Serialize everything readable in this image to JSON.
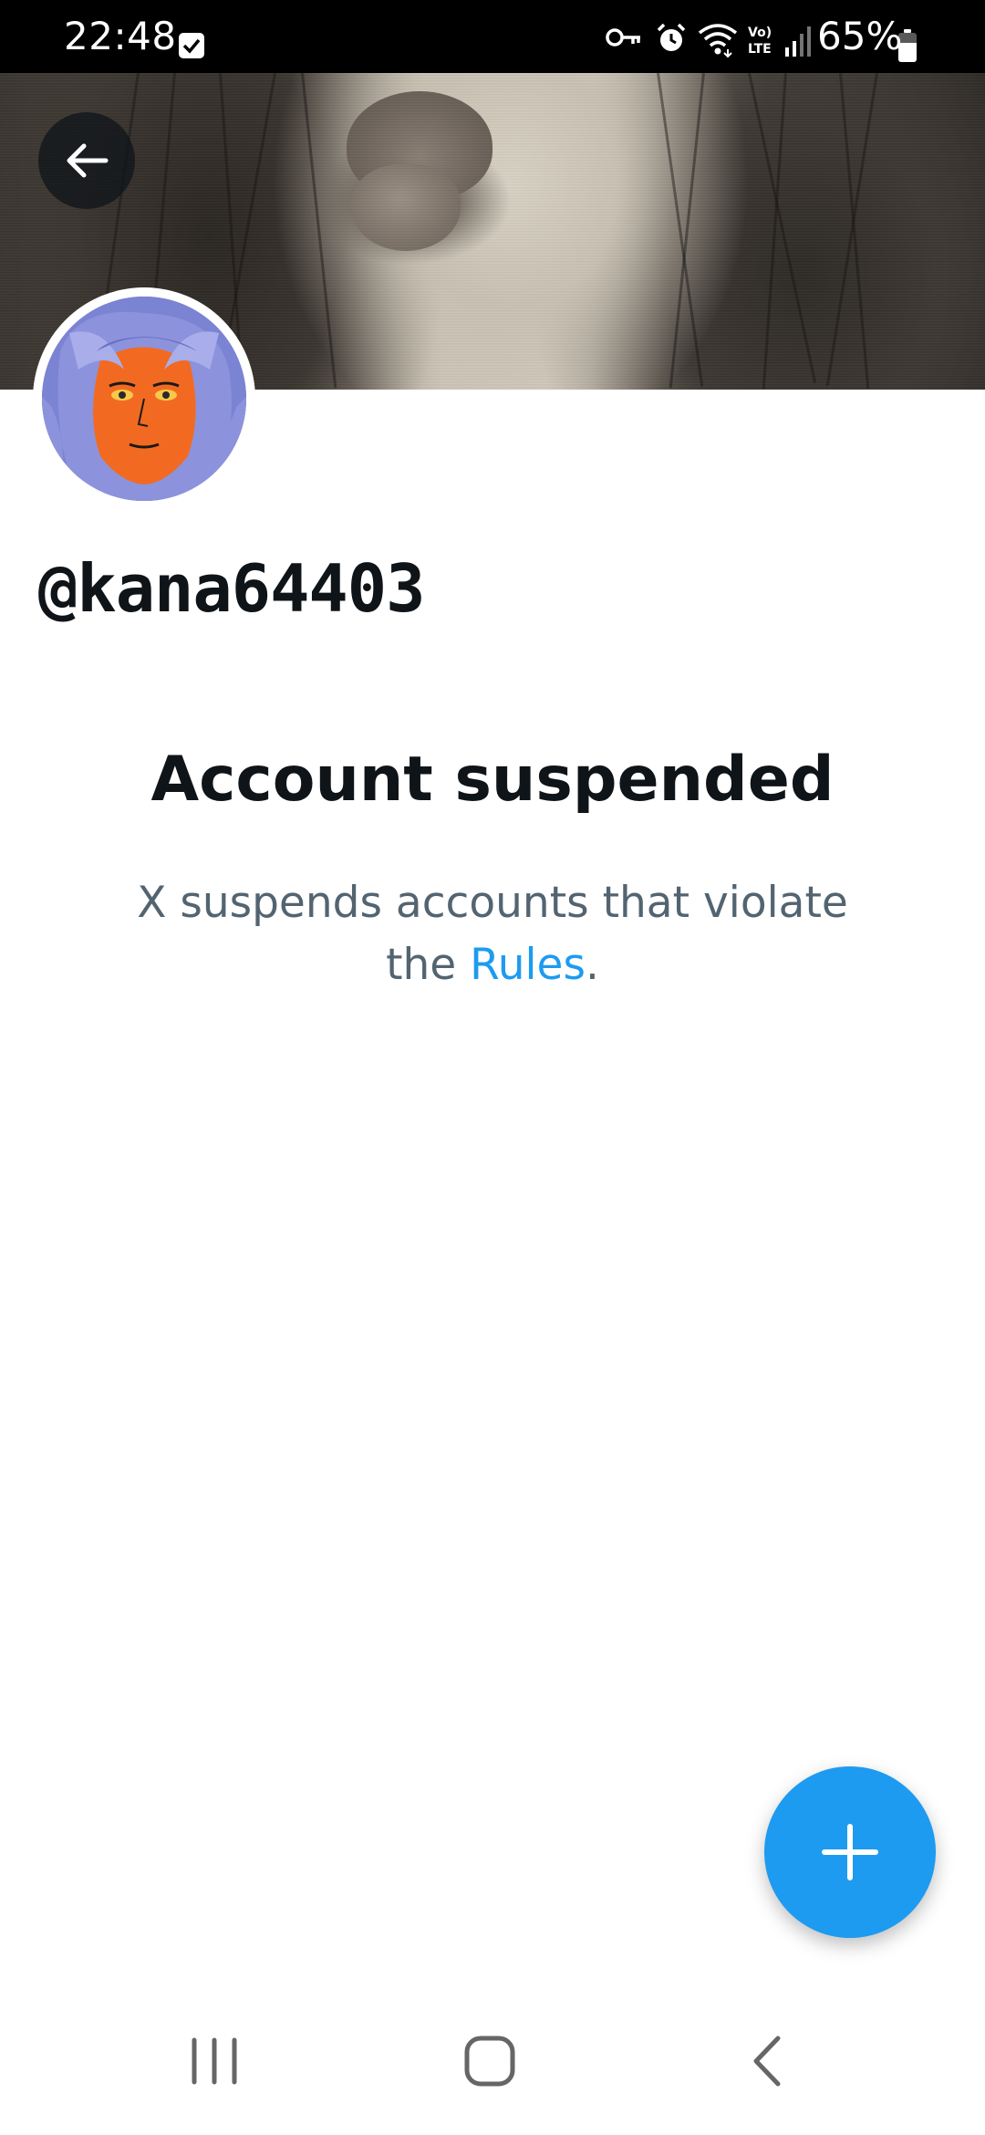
{
  "status_bar": {
    "time": "22:48",
    "battery_percent": "65%",
    "battery_level": 0.65,
    "icons": [
      "check-box-icon",
      "vpn-key-icon",
      "alarm-icon",
      "wifi-icon",
      "volte-icon",
      "signal-icon",
      "battery-icon"
    ]
  },
  "profile": {
    "handle": "@kana64403"
  },
  "suspension": {
    "title": "Account suspended",
    "message_before": "X suspends accounts that violate the ",
    "link_text": "Rules",
    "message_after": "."
  },
  "colors": {
    "link": "#1d9bf0",
    "fab": "#1d9bf0",
    "text_primary": "#0f1419",
    "text_secondary": "#536471"
  },
  "nav": {
    "icons": [
      "recent-apps-icon",
      "home-icon",
      "back-icon"
    ]
  }
}
